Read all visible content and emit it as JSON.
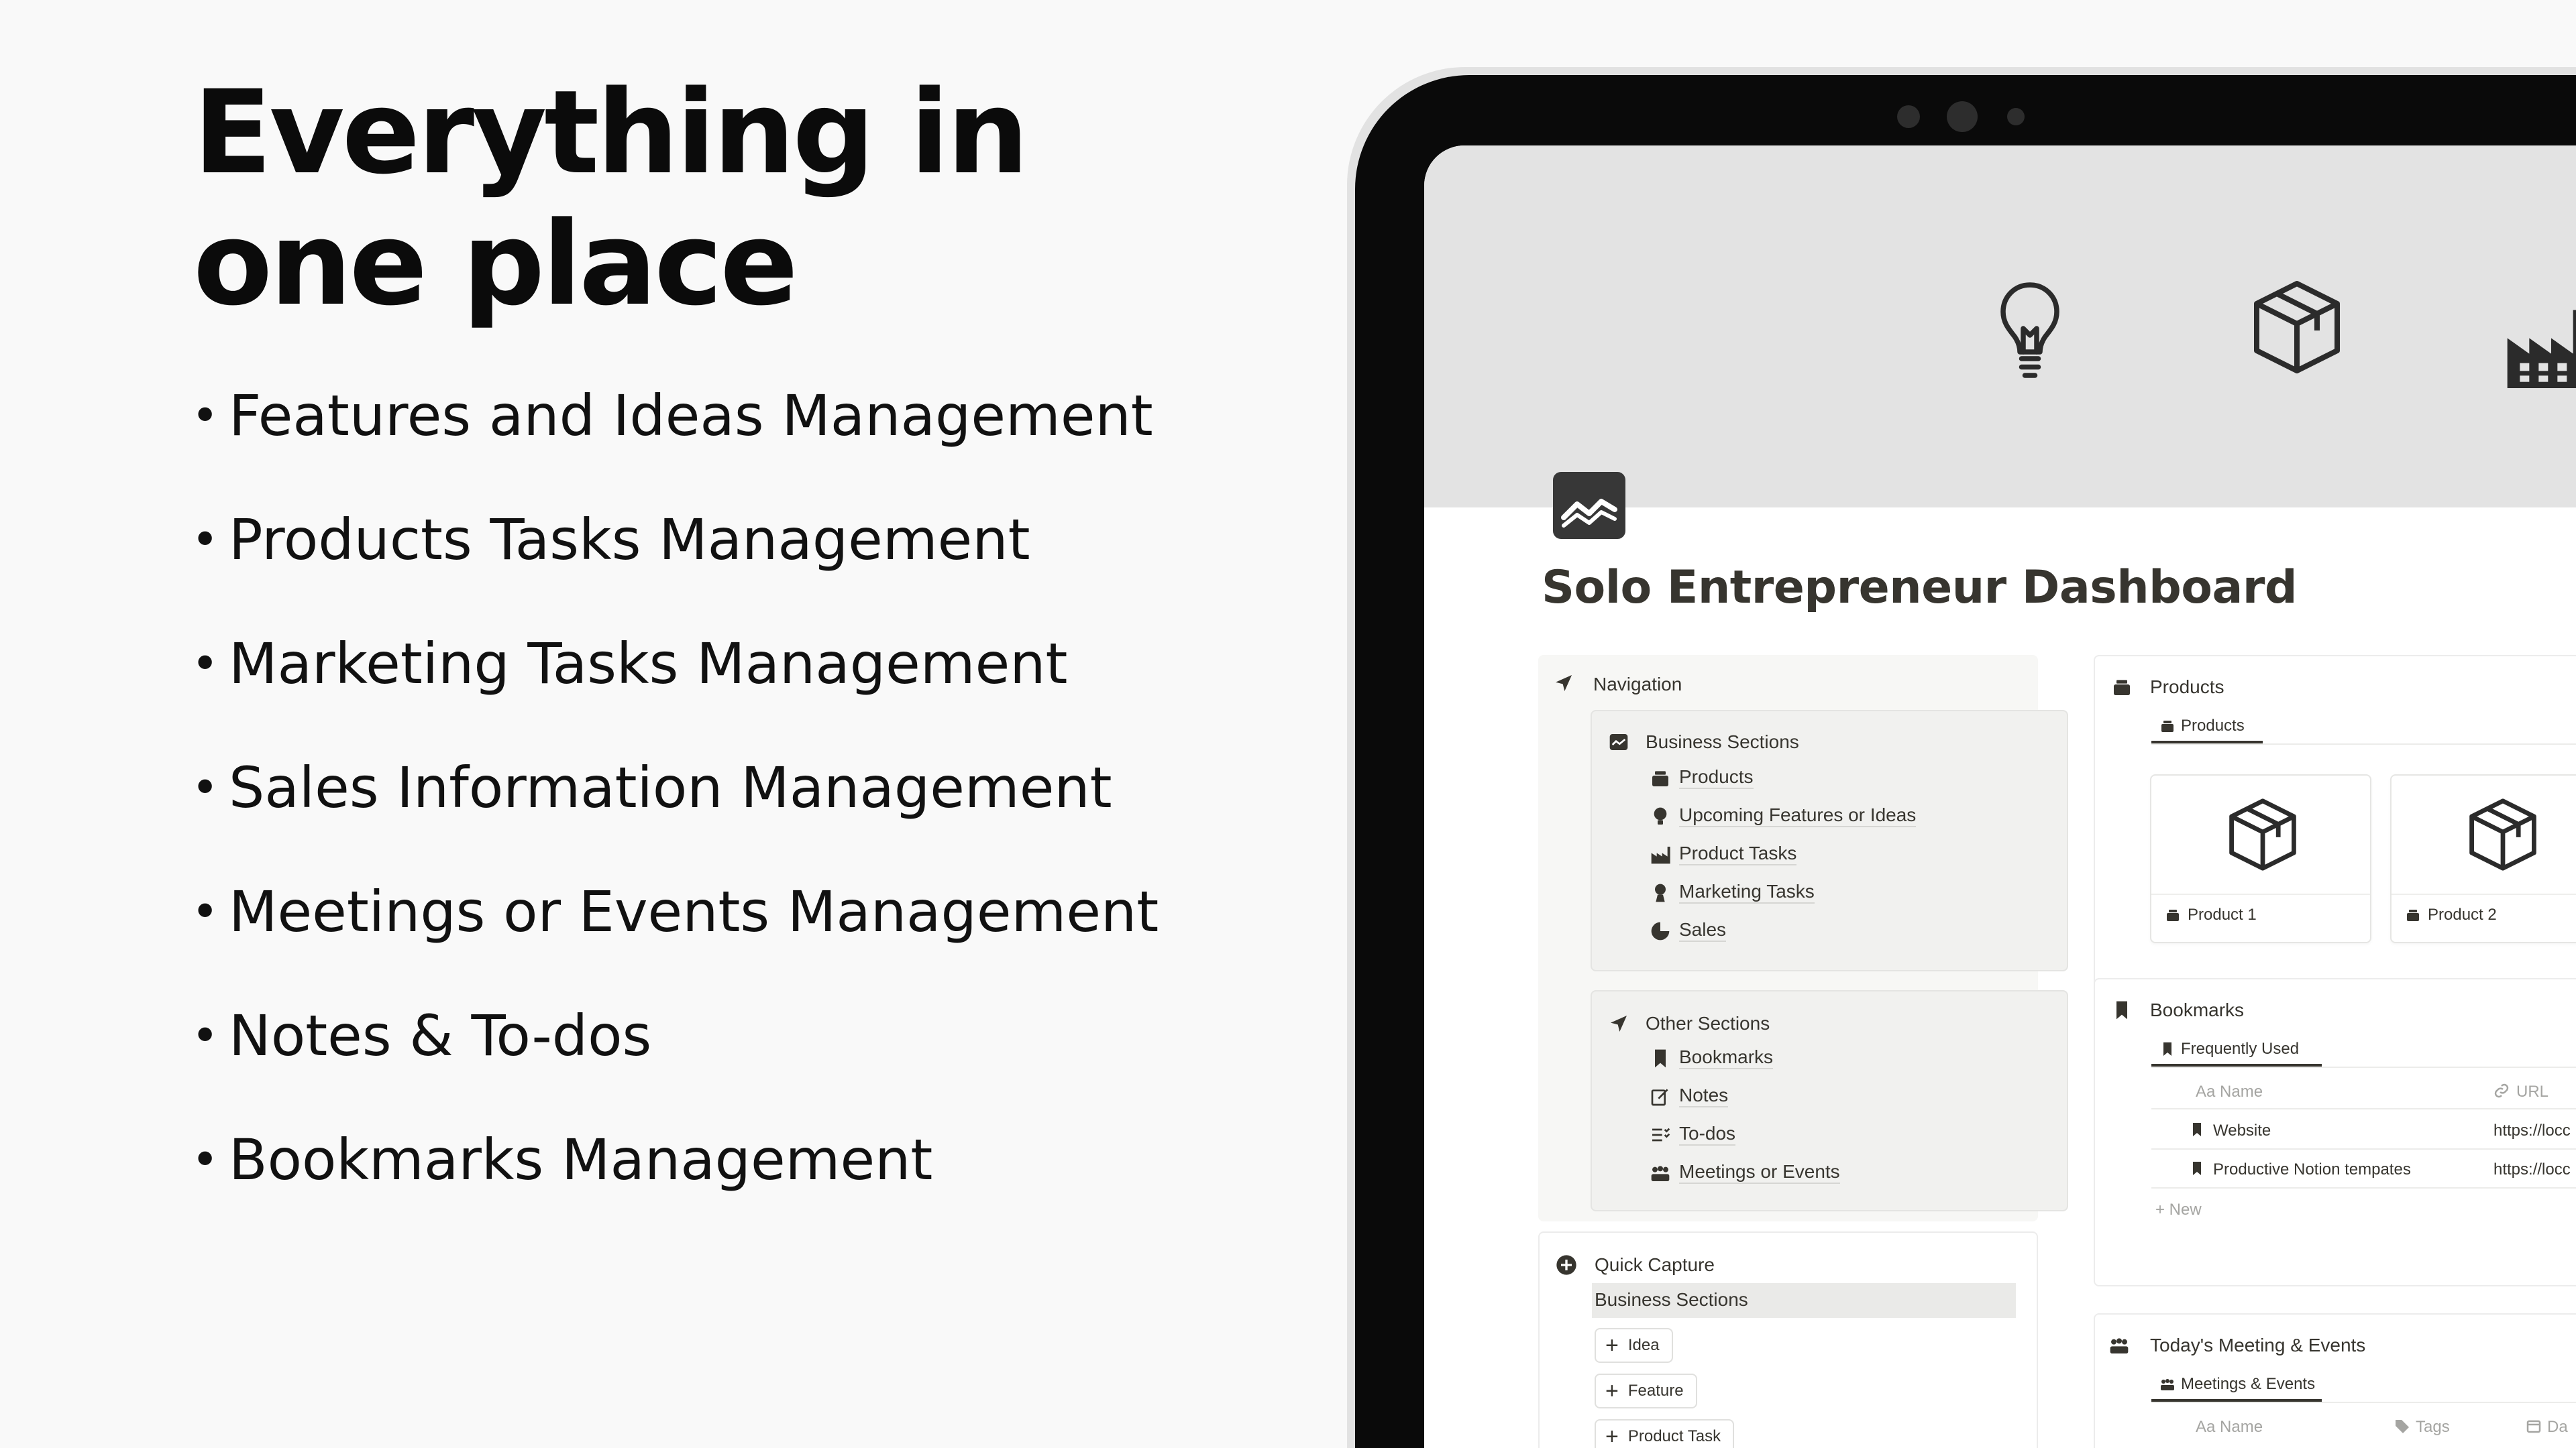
{
  "headline": {
    "line1": "Everything in",
    "line2": "one place"
  },
  "bullet_glyph": "•",
  "features": [
    "Features and Ideas Management",
    "Products Tasks Management",
    "Marketing Tasks Management",
    "Sales Information Management",
    "Meetings or Events Management",
    "Notes & To-dos",
    "Bookmarks Management"
  ],
  "dashboard": {
    "title": "Solo Entrepreneur Dashboard",
    "page_icon": "chart-icon",
    "cover_icons": [
      "lightbulb-icon",
      "box-icon",
      "factory-icon"
    ],
    "navigation": {
      "heading": "Navigation",
      "business": {
        "heading": "Business Sections",
        "items": [
          "Products",
          "Upcoming Features or Ideas",
          "Product Tasks",
          "Marketing Tasks",
          "Sales"
        ]
      },
      "other": {
        "heading": "Other Sections",
        "items": [
          "Bookmarks",
          "Notes",
          "To-dos",
          "Meetings or Events"
        ]
      }
    },
    "quick_capture": {
      "heading": "Quick Capture",
      "band_label": "Business Sections",
      "buttons": [
        "Idea",
        "Feature",
        "Product Task"
      ],
      "plus_glyph": "+"
    },
    "products": {
      "heading": "Products",
      "tab": "Products",
      "cards": [
        "Product 1",
        "Product 2"
      ]
    },
    "bookmarks": {
      "heading": "Bookmarks",
      "tab": "Frequently Used",
      "col_name": "Aa Name",
      "col_url": "URL",
      "rows": [
        {
          "name": "Website",
          "url": "https://locc"
        },
        {
          "name": "Productive Notion tempates",
          "url": "https://locc"
        }
      ],
      "new_label": "+ New"
    },
    "meetings": {
      "heading": "Today's Meeting & Events",
      "tab": "Meetings & Events",
      "col_name": "Aa Name",
      "col_tags": "Tags",
      "col_date": "Da"
    }
  },
  "colors": {
    "text": "#37352f",
    "panel": "#f7f7f5",
    "cover": "#e3e3e3",
    "frame": "#0a0a0a"
  }
}
